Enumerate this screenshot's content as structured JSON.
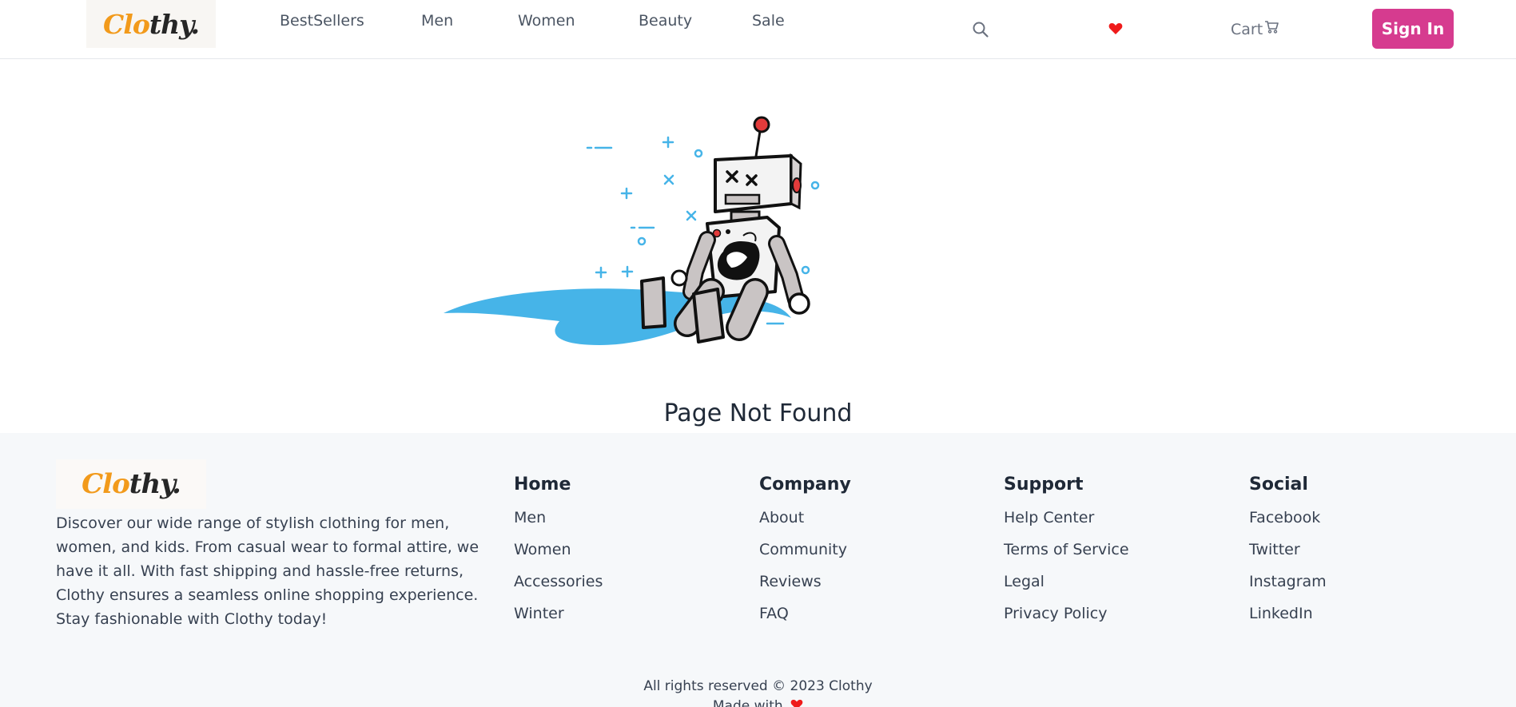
{
  "brand": {
    "part1": "Clo",
    "part2": "thy."
  },
  "nav": {
    "items": [
      {
        "label": "BestSellers"
      },
      {
        "label": "Men"
      },
      {
        "label": "Women"
      },
      {
        "label": "Beauty"
      },
      {
        "label": "Sale"
      }
    ],
    "cart_label": "Cart",
    "signin_label": "Sign In"
  },
  "icons": {
    "search": "search-icon",
    "wishlist": "heart-icon",
    "cart": "cart-icon"
  },
  "colors": {
    "brand_orange": "#f29a1b",
    "signin_bg": "#d63b8f",
    "heart": "#ef1b1b",
    "illustration_blue": "#46b4e8"
  },
  "main": {
    "title": "Page Not Found"
  },
  "footer": {
    "description": "Discover our wide range of stylish clothing for men, women, and kids. From casual wear to formal attire, we have it all. With fast shipping and hassle-free returns, Clothy ensures a seamless online shopping experience. Stay fashionable with Clothy today!",
    "columns": [
      {
        "title": "Home",
        "links": [
          "Men",
          "Women",
          "Accessories",
          "Winter"
        ]
      },
      {
        "title": "Company",
        "links": [
          "About",
          "Community",
          "Reviews",
          "FAQ"
        ]
      },
      {
        "title": "Support",
        "links": [
          "Help Center",
          "Terms of Service",
          "Legal",
          "Privacy Policy"
        ]
      },
      {
        "title": "Social",
        "links": [
          "Facebook",
          "Twitter",
          "Instagram",
          "LinkedIn"
        ]
      }
    ],
    "rights": "All rights reserved © 2023 Clothy",
    "made_with": "Made with"
  }
}
